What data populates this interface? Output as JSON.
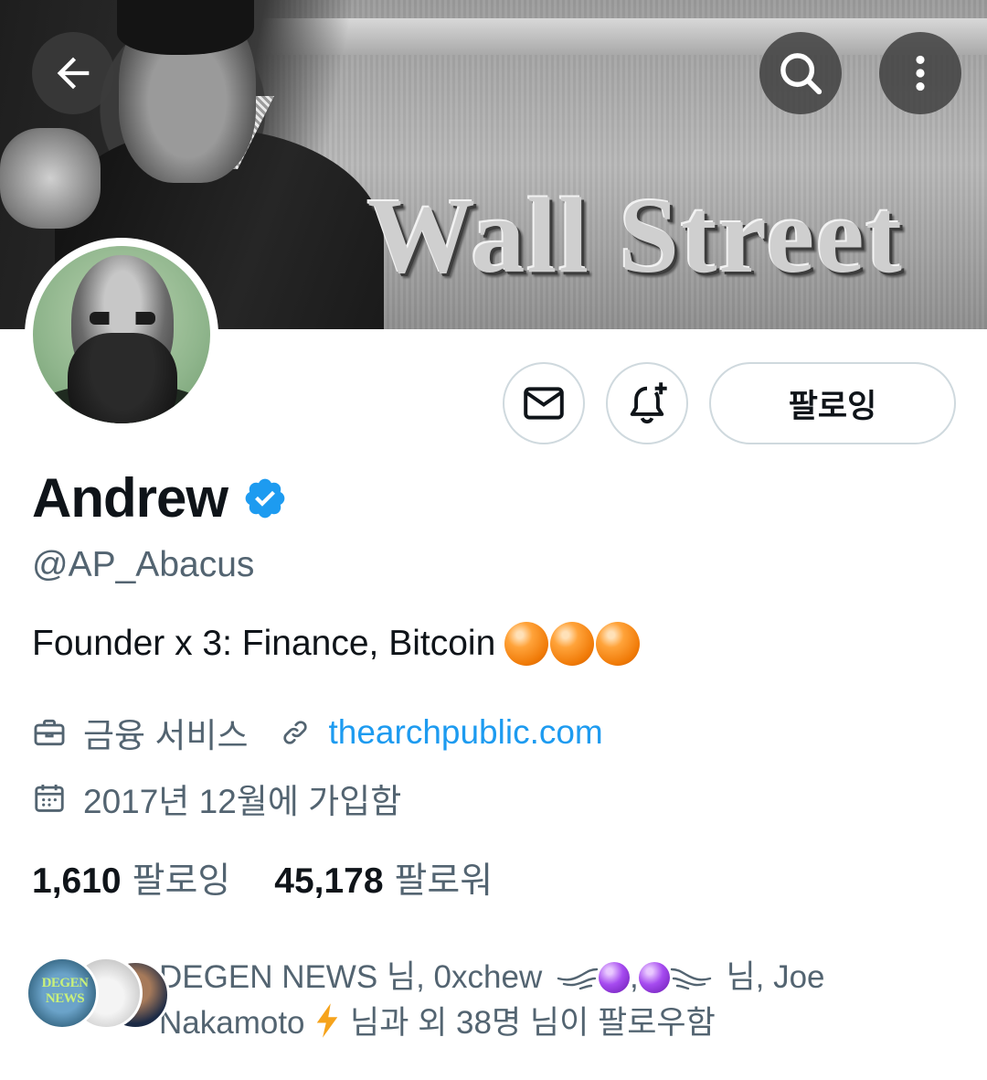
{
  "banner": {
    "text": "Wall Street"
  },
  "nav": {
    "back_icon": "arrow-left-icon",
    "search_icon": "search-icon",
    "more_icon": "more-vertical-icon"
  },
  "actions": {
    "message_icon": "envelope-icon",
    "notify_icon": "bell-plus-icon",
    "follow_label": "팔로잉"
  },
  "profile": {
    "name": "Andrew",
    "handle": "@AP_Abacus",
    "bio": "Founder x 3: Finance, Bitcoin",
    "category": "금융 서비스",
    "website": "thearchpublic.com",
    "joined": "2017년 12월에 가입함"
  },
  "stats": {
    "following_count": "1,610",
    "following_label": "팔로잉",
    "followers_count": "45,178",
    "followers_label": "팔로워"
  },
  "known_followers": {
    "avatar1_text": "DEGEN NEWS",
    "part1": "DEGEN NEWS 님, 0xchew",
    "part2": ",",
    "part3": "님, Joe",
    "part4": "Nakamoto",
    "part5": "님과 외 38명 님이 팔로우함"
  },
  "colors": {
    "accent": "#1d9bf0",
    "secondary_text": "#536471",
    "primary_text": "#0f1419",
    "border": "#cfd9de"
  }
}
